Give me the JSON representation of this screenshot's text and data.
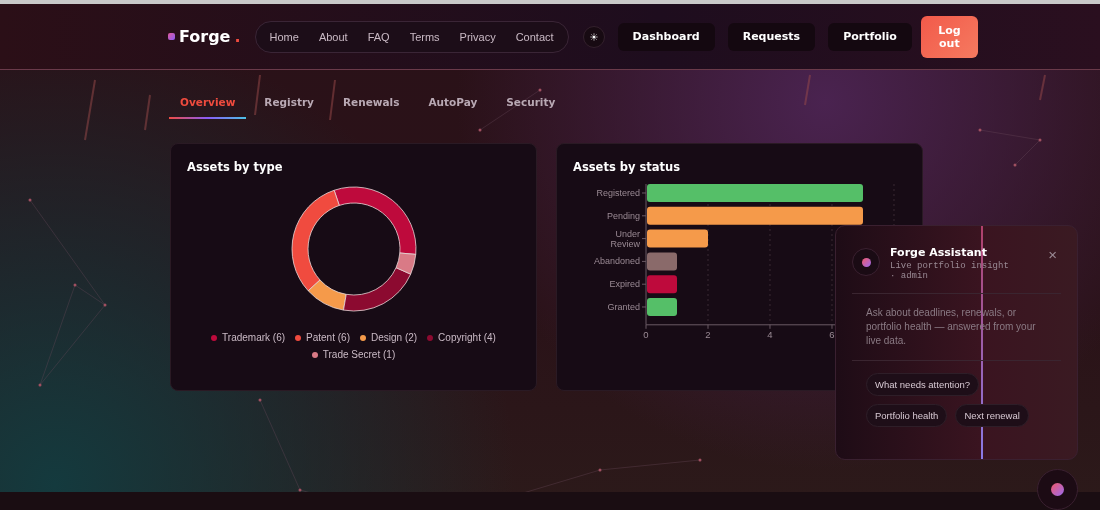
{
  "brand": {
    "name": "Forge",
    "dot": "."
  },
  "nav": [
    {
      "label": "Home"
    },
    {
      "label": "About"
    },
    {
      "label": "FAQ"
    },
    {
      "label": "Terms"
    },
    {
      "label": "Privacy"
    },
    {
      "label": "Contact"
    }
  ],
  "actions": [
    {
      "label": "Dashboard",
      "kind": "dark"
    },
    {
      "label": "Requests",
      "kind": "dark"
    },
    {
      "label": "Portfolio",
      "kind": "dark"
    },
    {
      "label": "Log out",
      "kind": "primary"
    }
  ],
  "tabs": [
    {
      "label": "Overview",
      "selected": true
    },
    {
      "label": "Registry",
      "selected": false
    },
    {
      "label": "Renewals",
      "selected": false
    },
    {
      "label": "AutoPay",
      "selected": false
    },
    {
      "label": "Security",
      "selected": false
    }
  ],
  "type_card": {
    "title": "Assets by type",
    "chart_data": {
      "type": "donut",
      "categories": [
        "Trademark (6)",
        "Patent (6)",
        "Design (2)",
        "Copyright (4)",
        "Trade Secret (1)"
      ],
      "values": [
        6,
        6,
        2,
        4,
        1
      ],
      "legend": "bottom",
      "colors": [
        "#be0a3c",
        "#f04b3f",
        "#f59a4a",
        "#8c0a30",
        "#d97a86"
      ]
    }
  },
  "status_card": {
    "title": "Assets by status",
    "chart_data": {
      "type": "bar",
      "orientation": "horizontal",
      "categories": [
        "Registered",
        "Pending",
        "Under Review",
        "Abandoned",
        "Expired",
        "Granted"
      ],
      "values": [
        7,
        7,
        2,
        1,
        1,
        1
      ],
      "grid": true,
      "colors": [
        "#55bf68",
        "#f59a4a",
        "#f59a4a",
        "#8a6a6a",
        "#be0a3c",
        "#55bf68"
      ],
      "xlim": [
        0,
        8
      ],
      "xticks": [
        0,
        2,
        4,
        6
      ]
    }
  },
  "assistant": {
    "title": "Forge Assistant",
    "subtitle": "Live portfolio insight · admin",
    "close": "×",
    "message": "Ask about deadlines, renewals, or portfolio health — answered from your live data.",
    "suggestions": [
      {
        "label": "What needs attention?"
      },
      {
        "label": "Portfolio health"
      },
      {
        "label": "Next renewal"
      }
    ]
  }
}
